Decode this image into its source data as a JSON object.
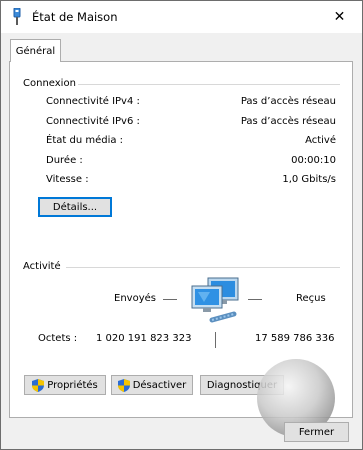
{
  "window": {
    "title": "État de Maison",
    "close_glyph": "✕"
  },
  "tabs": [
    {
      "label": "Général"
    }
  ],
  "connection": {
    "heading": "Connexion",
    "rows": [
      {
        "label": "Connectivité IPv4 :",
        "value": "Pas d’accès réseau"
      },
      {
        "label": "Connectivité IPv6 :",
        "value": "Pas d’accès réseau"
      },
      {
        "label": "État du média :",
        "value": "Activé"
      },
      {
        "label": "Durée :",
        "value": "00:00:10"
      },
      {
        "label": "Vitesse :",
        "value": "1,0 Gbits/s"
      }
    ],
    "details_button": "Détails..."
  },
  "activity": {
    "heading": "Activité",
    "sent_label": "Envoyés",
    "received_label": "Reçus",
    "bytes_label": "Octets :",
    "bytes_sent": "1 020 191 823 323",
    "bytes_received": "17 589 786 336"
  },
  "buttons": {
    "properties": "Propriétés",
    "disable": "Désactiver",
    "diagnose": "Diagnostiquer",
    "close": "Fermer"
  },
  "icons": {
    "title": "network-adapter-icon",
    "activity": "network-computers-icon",
    "uac": "uac-shield-icon"
  },
  "colors": {
    "accent": "#0078d7",
    "button_face": "#e1e1e1"
  }
}
